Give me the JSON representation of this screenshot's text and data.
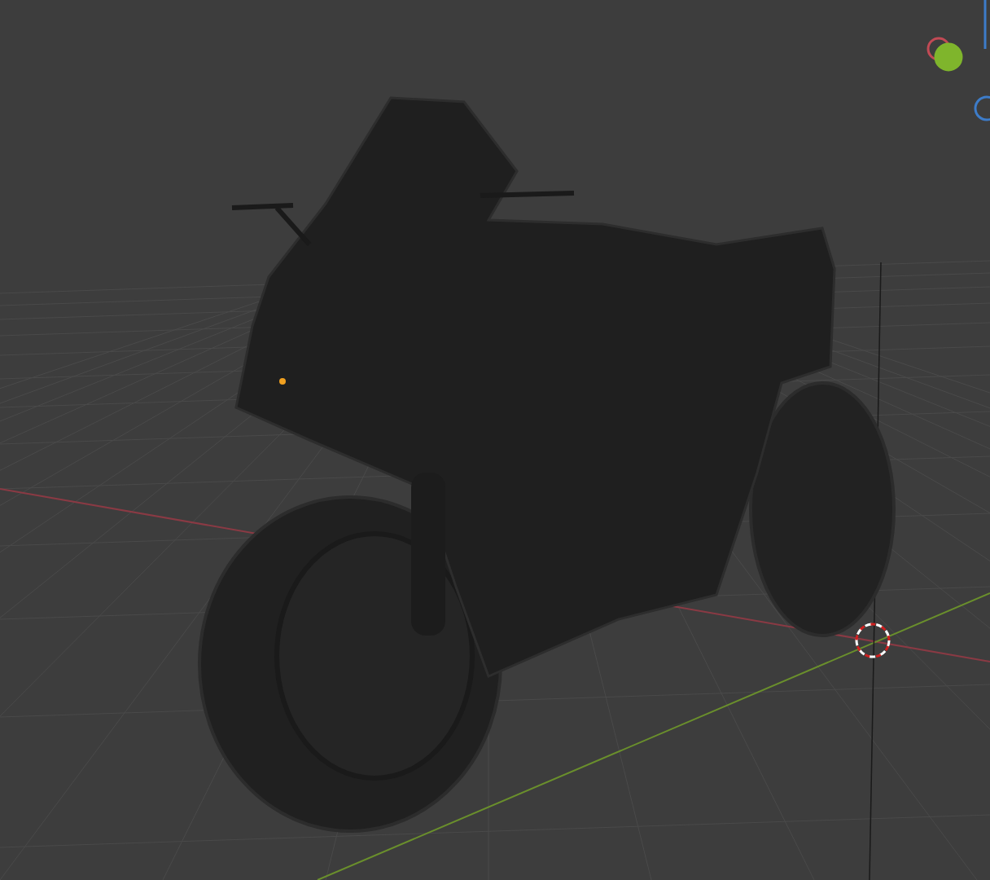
{
  "viewport": {
    "gizmo": {
      "axes": [
        {
          "kind": "outline",
          "color": "#c24a55"
        },
        {
          "kind": "filled",
          "color": "#7fb52c"
        },
        {
          "kind": "outline",
          "color": "#3d7cc9"
        }
      ]
    }
  }
}
